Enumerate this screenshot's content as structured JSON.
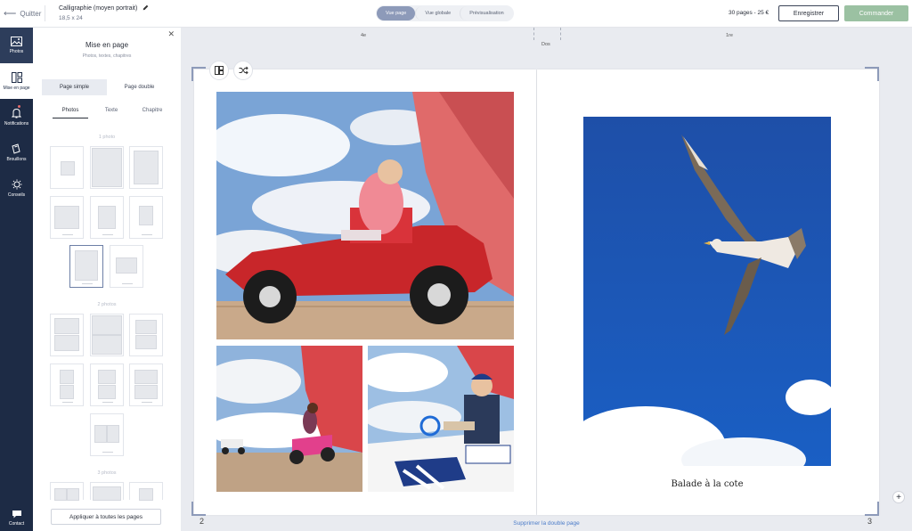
{
  "header": {
    "quit_label": "Quitter",
    "product_name": "Calligraphie (moyen portrait)",
    "product_size": "18,5 x 24",
    "view_tabs": [
      "Vue page",
      "Vue globale",
      "Prévisualisation"
    ],
    "pages_price": "30 pages - 25 €",
    "save_label": "Enregistrer",
    "order_label": "Commander"
  },
  "rail": {
    "items": [
      {
        "label": "Photos",
        "icon": "image-icon"
      },
      {
        "label": "Mise en page",
        "icon": "layout-icon"
      },
      {
        "label": "Notifications",
        "icon": "bell-icon"
      },
      {
        "label": "Brouillons",
        "icon": "drafts-icon"
      },
      {
        "label": "Conseils",
        "icon": "lightbulb-icon"
      }
    ],
    "contact_label": "Contact"
  },
  "panel": {
    "title": "Mise en page",
    "subtitle": "Photos, textes, chapitres",
    "page_types": [
      "Page simple",
      "Page double"
    ],
    "tabs": [
      "Photos",
      "Texte",
      "Chapitre"
    ],
    "section_one": "1 photo",
    "section_two": "2 photos",
    "section_three": "3 photos",
    "apply_label": "Appliquer à toutes les pages"
  },
  "workspace": {
    "ruler_left": "4e",
    "ruler_spine": "Dos",
    "ruler_right": "1re",
    "caption": "Balade à la cote",
    "page_left": "2",
    "page_right": "3",
    "delete_label": "Supprimer la double page",
    "add_symbol": "+"
  },
  "colors": {
    "rail_bg": "#1d2b45",
    "accent": "#8d9ab9",
    "order_button": "#9bc1a2",
    "link": "#4a7bc8"
  }
}
